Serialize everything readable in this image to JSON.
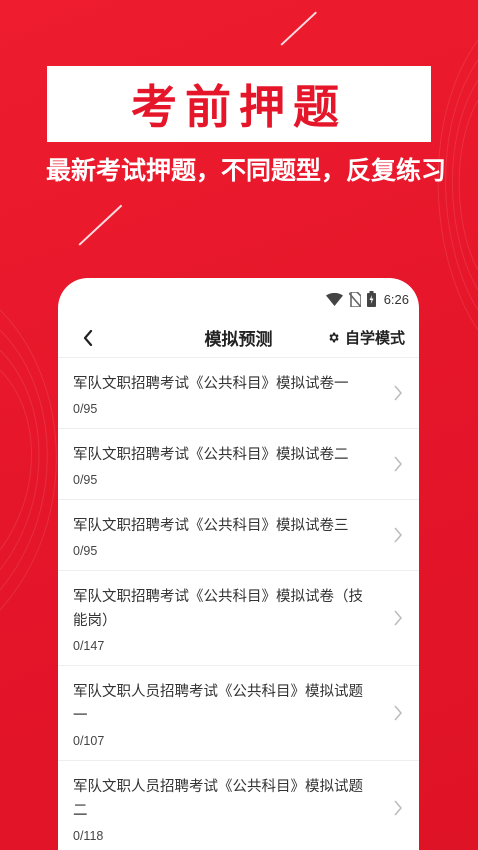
{
  "promo": {
    "title": "考前押题",
    "subtitle": "最新考试押题，不同题型，反复练习"
  },
  "status_bar": {
    "time": "6:26",
    "icons": [
      "wifi-icon",
      "no-sim-icon",
      "battery-charging-icon"
    ]
  },
  "nav": {
    "back_icon": "back-chevron-icon",
    "title": "模拟预测",
    "self_mode_icon": "gear-icon",
    "self_mode_label": "自学模式"
  },
  "papers": [
    {
      "title": "军队文职招聘考试《公共科目》模拟试卷一",
      "progress": "0/95"
    },
    {
      "title": "军队文职招聘考试《公共科目》模拟试卷二",
      "progress": "0/95"
    },
    {
      "title": "军队文职招聘考试《公共科目》模拟试卷三",
      "progress": "0/95"
    },
    {
      "title": "军队文职招聘考试《公共科目》模拟试卷（技能岗）",
      "progress": "0/147"
    },
    {
      "title": "军队文职人员招聘考试《公共科目》模拟试题一",
      "progress": "0/107"
    },
    {
      "title": "军队文职人员招聘考试《公共科目》模拟试题二",
      "progress": "0/118"
    }
  ],
  "colors": {
    "brand_red": "#e5152a",
    "background_red": "#ee1c2e",
    "card": "#ffffff"
  }
}
